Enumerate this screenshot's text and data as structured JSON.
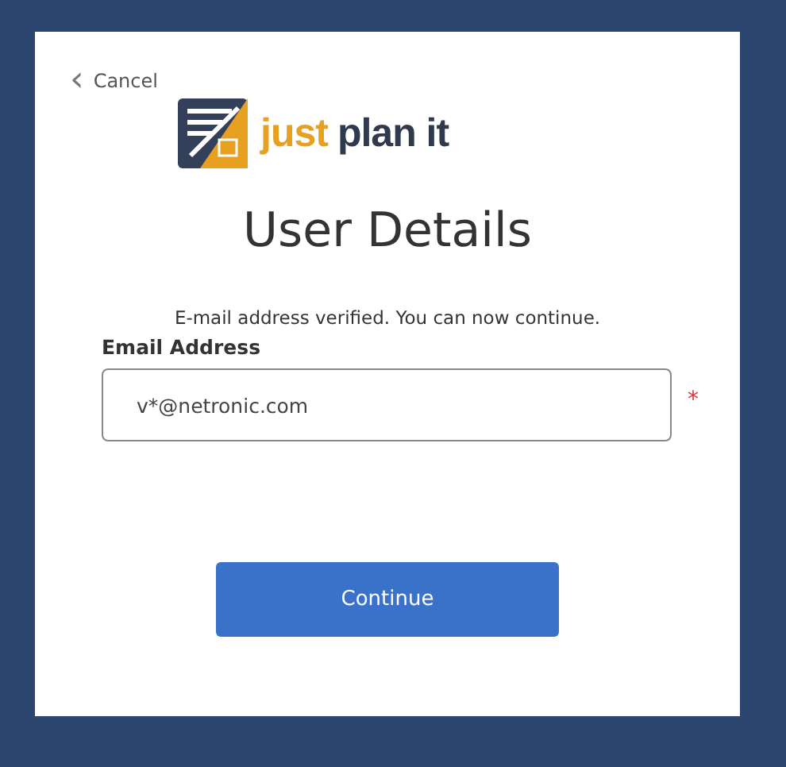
{
  "back_link": {
    "icon": "‹",
    "label": "Cancel"
  },
  "logo": {
    "word_1": "just",
    "word_2": "plan it"
  },
  "title": "User Details",
  "message": "E-mail address verified. You can now continue.",
  "email_field": {
    "label": "Email Address",
    "value": "v*@netronic.com",
    "required": true,
    "required_mark": "*"
  },
  "button": "Continue"
}
